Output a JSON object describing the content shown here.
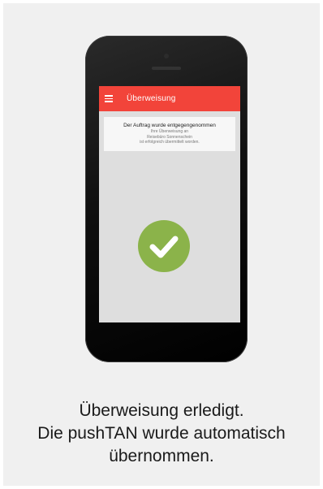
{
  "app": {
    "title": "Überweisung"
  },
  "message": {
    "title": "Der Auftrag wurde entgegengenommen",
    "lines": [
      "Ihre Überweisung an",
      "Reisebüro Sonnenschein",
      "ist erfolgreich übermittelt worden."
    ]
  },
  "status_icon": "check-circle-icon",
  "caption": {
    "lines": [
      "Überweisung erledigt.",
      "Die pushTAN wurde automatisch",
      "übernommen."
    ]
  },
  "colors": {
    "appbar": "#f2443a",
    "success": "#8bb34a",
    "card_background": "#f0f0f0"
  }
}
